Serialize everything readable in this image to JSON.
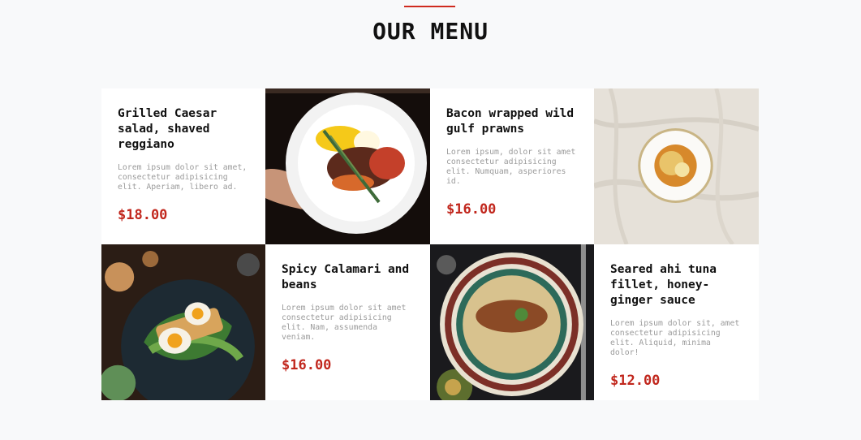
{
  "section": {
    "title": "OUR MENU"
  },
  "menu": {
    "items": [
      {
        "name": "Grilled Caesar salad, shaved reggiano",
        "description": "Lorem ipsum dolor sit amet, consectetur adipisicing elit. Aperiam, libero ad.",
        "price": "$18.00"
      },
      {
        "name": "Bacon wrapped wild gulf prawns",
        "description": "Lorem ipsum, dolor sit amet consectetur adipisicing elit. Numquam, asperiores id.",
        "price": "$16.00"
      },
      {
        "name": "Spicy Calamari and beans",
        "description": "Lorem ipsum dolor sit amet consectetur adipisicing elit. Nam, assumenda veniam.",
        "price": "$16.00"
      },
      {
        "name": "Seared ahi tuna fillet, honey-ginger sauce",
        "description": "Lorem ipsum dolor sit, amet consectetur adipisicing elit. Aliquid, minima dolor!",
        "price": "$12.00"
      }
    ]
  },
  "colors": {
    "accent": "#cf2a1e",
    "price": "#c1271d",
    "background": "#f8f9fa",
    "card": "#ffffff"
  }
}
